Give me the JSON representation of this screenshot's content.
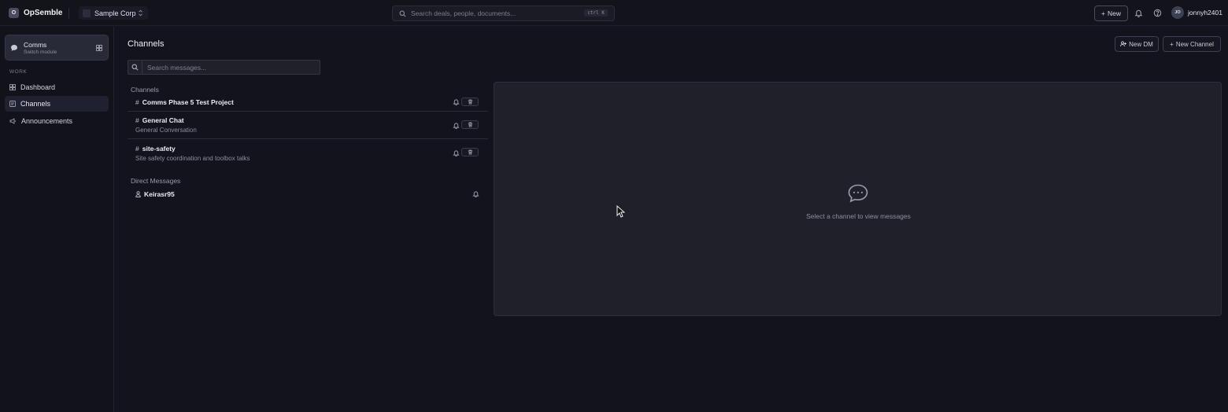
{
  "app": {
    "logo_letter": "O",
    "name": "OpSemble"
  },
  "org": {
    "name": "Sample Corp"
  },
  "search": {
    "placeholder": "Search deals, people, documents...",
    "shortcut": "ctrl K"
  },
  "topbar": {
    "new_label": "New",
    "user": {
      "initials": "JO",
      "name": "jonnyh2401"
    }
  },
  "sidebar": {
    "module": {
      "name": "Comms",
      "subtitle": "Switch module"
    },
    "section_label": "WORK",
    "items": [
      {
        "label": "Dashboard",
        "icon": "grid-icon",
        "active": false
      },
      {
        "label": "Channels",
        "icon": "channel-icon",
        "active": true
      },
      {
        "label": "Announcements",
        "icon": "megaphone-icon",
        "active": false
      }
    ]
  },
  "main": {
    "title": "Channels",
    "new_dm_label": "New DM",
    "new_channel_label": "New Channel",
    "message_search_placeholder": "Search messages...",
    "channels_heading": "Channels",
    "channels": [
      {
        "name": "Comms Phase 5 Test Project",
        "description": ""
      },
      {
        "name": "General Chat",
        "description": "General Conversation"
      },
      {
        "name": "site-safety",
        "description": "Site safety coordination and toolbox talks"
      }
    ],
    "dm_heading": "Direct Messages",
    "direct_messages": [
      {
        "name": "Keirasr95"
      }
    ],
    "empty_state": "Select a channel to view messages"
  },
  "colors": {
    "background": "#12131c",
    "panel": "#1f2029",
    "active_nav": "#1f2030"
  }
}
